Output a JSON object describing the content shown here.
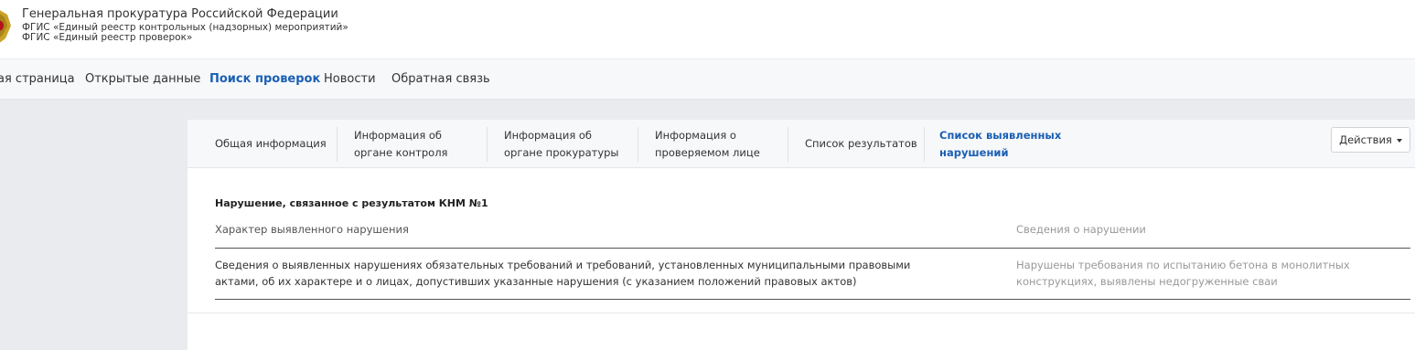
{
  "header": {
    "org_name": "Генеральная прокуратура Российской Федерации",
    "subtitle_1": "ФГИС «Единый реестр контрольных (надзорных) мероприятий»",
    "subtitle_2": "ФГИС «Единый реестр проверок»"
  },
  "nav": {
    "items": [
      {
        "label": "ая страница"
      },
      {
        "label": "Открытые данные"
      },
      {
        "label": "Поиск проверок",
        "active": true
      },
      {
        "label": "Новости"
      },
      {
        "label": "Обратная связь"
      }
    ]
  },
  "tabs": [
    {
      "label": "Общая информация"
    },
    {
      "label": "Информация об органе контроля"
    },
    {
      "label": "Информация об органе прокуратуры"
    },
    {
      "label": "Информация о проверяемом лице"
    },
    {
      "label": "Список результатов"
    },
    {
      "label": "Список выявленных нарушений",
      "active": true
    }
  ],
  "actions": {
    "label": "Действия"
  },
  "violation": {
    "title": "Нарушение, связанное с результатом КНМ №1",
    "col_left_header": "Характер выявленного нарушения",
    "col_right_header": "Сведения о нарушении",
    "col_left_value": "Сведения о выявленных нарушениях обязательных требований и требований, установленных муниципальными правовыми актами, об их характере и о лицах, допустивших указанные нарушения (с указанием положений правовых актов)",
    "col_right_value": "Нарушены требования по испытанию бетона в монолитных конструкциях, выявлены недогруженные сваи"
  },
  "colors": {
    "accent": "#1a5fb4",
    "nav_bg": "#f7f8fa",
    "page_bg": "#e9ebee",
    "emblem_gold": "#c9a227"
  },
  "icons": {
    "emblem": "coat-of-arms-icon",
    "caret": "caret-down-icon"
  }
}
